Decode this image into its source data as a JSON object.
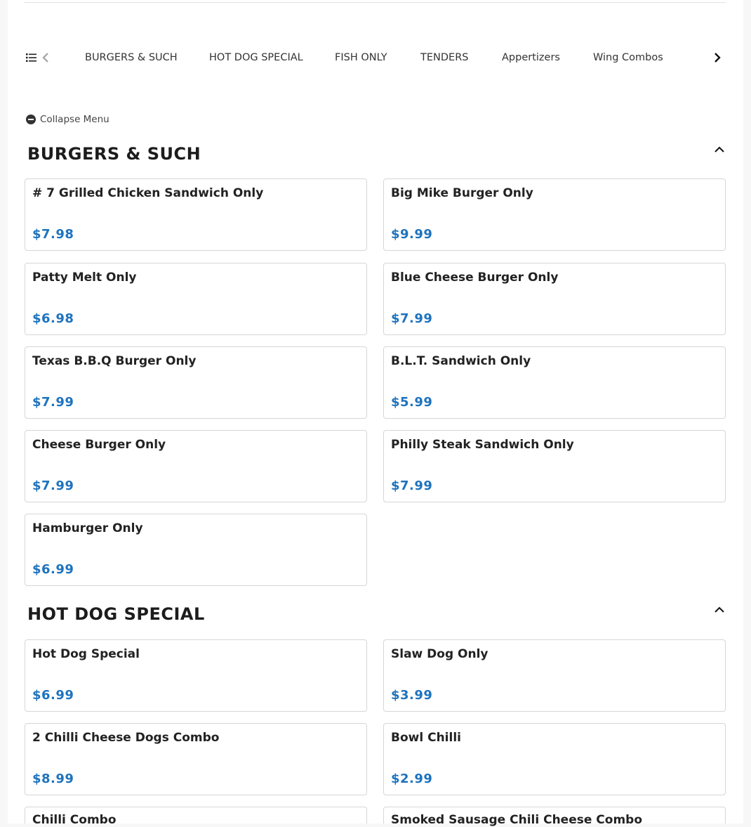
{
  "nav": {
    "tabs": [
      "BURGERS & SUCH",
      "HOT DOG SPECIAL",
      "FISH ONLY",
      "TENDERS",
      "Appertizers",
      "Wing Combos"
    ]
  },
  "collapse_label": "Collapse Menu",
  "sections": [
    {
      "title": "BURGERS & SUCH",
      "items": [
        {
          "name": "# 7 Grilled Chicken Sandwich Only",
          "price": "$7.98"
        },
        {
          "name": "Big Mike Burger Only",
          "price": "$9.99"
        },
        {
          "name": "Patty Melt Only",
          "price": "$6.98"
        },
        {
          "name": "Blue Cheese Burger Only",
          "price": "$7.99"
        },
        {
          "name": "Texas B.B.Q Burger Only",
          "price": "$7.99"
        },
        {
          "name": "B.L.T. Sandwich Only",
          "price": "$5.99"
        },
        {
          "name": "Cheese Burger Only",
          "price": "$7.99"
        },
        {
          "name": "Philly Steak Sandwich Only",
          "price": "$7.99"
        },
        {
          "name": "Hamburger Only",
          "price": "$6.99"
        }
      ]
    },
    {
      "title": "HOT DOG SPECIAL",
      "items": [
        {
          "name": "Hot Dog Special",
          "price": "$6.99"
        },
        {
          "name": "Slaw Dog Only",
          "price": "$3.99"
        },
        {
          "name": "2 Chilli Cheese Dogs Combo",
          "price": "$8.99"
        },
        {
          "name": "Bowl Chilli",
          "price": "$2.99"
        },
        {
          "name": "Chilli Combo",
          "price": ""
        },
        {
          "name": "Smoked Sausage Chili Cheese Combo",
          "price": ""
        }
      ]
    }
  ],
  "colors": {
    "price": "#1e73be",
    "border": "#d6d6d6"
  }
}
